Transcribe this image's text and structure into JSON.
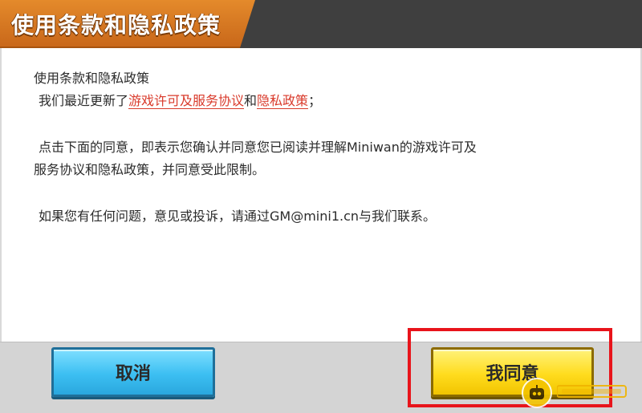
{
  "header": {
    "title": "使用条款和隐私政策"
  },
  "content": {
    "heading": "使用条款和隐私政策",
    "update_prefix": "我们最近更新了",
    "link_license": "游戏许可及服务协议",
    "and": "和",
    "link_privacy": "隐私政策",
    "update_suffix": "；",
    "para1_line1": "点击下面的同意，即表示您确认并同意您已阅读并理解Miniwan的游戏许可及",
    "para1_line2": "服务协议和隐私政策，并同意受此限制。",
    "para2": "如果您有任何问题，意见或投诉，请通过GM@mini1.cn与我们联系。"
  },
  "buttons": {
    "cancel_label": "取消",
    "agree_label": "我同意"
  },
  "colors": {
    "header_accent": "#e07f25",
    "link": "#d93a2b",
    "cancel_button": "#3cbff2",
    "agree_button": "#ffdc1e",
    "highlight_box": "#e8141b"
  },
  "watermark": {
    "icon": "robot-face-icon"
  }
}
